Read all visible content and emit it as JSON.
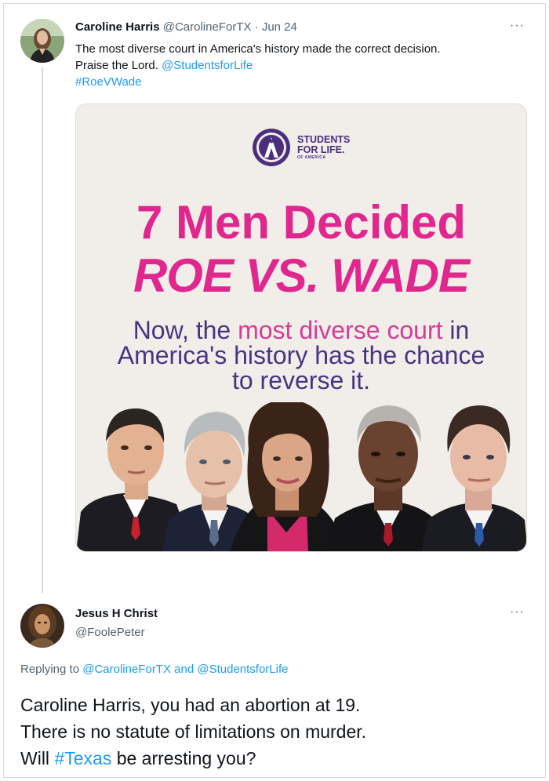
{
  "tweet1": {
    "name": "Caroline Harris",
    "handle": "@CarolineForTX",
    "separator": "·",
    "date": "Jun 24",
    "more": "···",
    "text_line1": "The most diverse court in America's history made the correct decision.",
    "text_line2_prefix": "Praise the Lord. ",
    "mention": "@StudentsforLife",
    "hashtag": "#RoeVWade"
  },
  "image": {
    "logo_line1": "STUDENTS",
    "logo_line2": "FOR LIFE.",
    "logo_line3": "OF AMERICA",
    "headline1": "7 Men Decided",
    "headline2": "ROE VS. WADE",
    "sub_part1": "Now, the ",
    "sub_highlight": "most diverse court",
    "sub_part2": " in",
    "sub_line2": "America's history has the chance",
    "sub_line3": "to reverse it."
  },
  "tweet2": {
    "name": "Jesus H Christ",
    "handle": "@FoolePeter",
    "more": "···",
    "replying_prefix": "Replying to ",
    "replying_user1": "@CarolineForTX",
    "replying_and": " and ",
    "replying_user2": "@StudentsforLife",
    "line1": "Caroline Harris, you had an abortion at 19.",
    "line2": "There is no statute of limitations on murder.",
    "line3_prefix": "Will ",
    "line3_hashtag": "#Texas",
    "line3_suffix": " be arresting you?"
  },
  "colors": {
    "link": "#1d9bf0",
    "pink": "#e0278e",
    "purple": "#4b3382"
  }
}
